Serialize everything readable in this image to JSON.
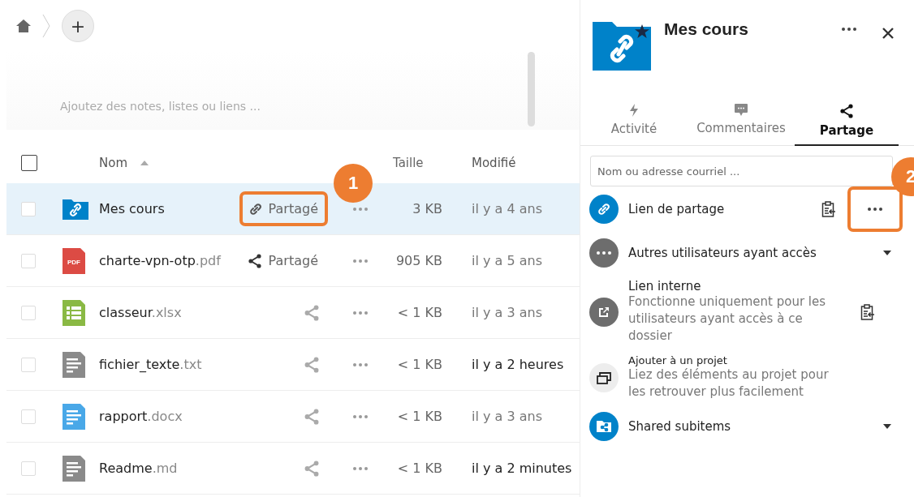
{
  "toolbar": {
    "add_label": "+"
  },
  "notes": {
    "placeholder": "Ajoutez des notes, listes ou liens ..."
  },
  "table": {
    "columns": [
      {
        "label": "Nom",
        "sorted": true
      },
      {
        "label": "Taille"
      },
      {
        "label": "Modifié"
      }
    ],
    "all_checked": false,
    "rows": [
      {
        "name": "Mes cours",
        "ext": "",
        "kind": "folder",
        "selected": true,
        "share": {
          "kind": "link",
          "label": "Partagé"
        },
        "callout": "1",
        "size": "3 KB",
        "modified": "il y a 4 ans",
        "recent": false
      },
      {
        "name": "charte-vpn-otp",
        "ext": ".pdf",
        "kind": "pdf",
        "icon_text": "PDF",
        "selected": false,
        "share": {
          "kind": "shared",
          "label": "Partagé"
        },
        "size": "905 KB",
        "modified": "il y a 5 ans",
        "recent": false
      },
      {
        "name": "classeur",
        "ext": ".xlsx",
        "kind": "spreadsheet",
        "selected": false,
        "share": {
          "kind": "none"
        },
        "size": "< 1 KB",
        "modified": "il y a 3 ans",
        "recent": false
      },
      {
        "name": "fichier_texte",
        "ext": ".txt",
        "kind": "text",
        "selected": false,
        "share": {
          "kind": "none"
        },
        "size": "< 1 KB",
        "modified": "il y a 2 heures",
        "recent": true
      },
      {
        "name": "rapport",
        "ext": ".docx",
        "kind": "document",
        "selected": false,
        "share": {
          "kind": "none"
        },
        "size": "< 1 KB",
        "modified": "il y a 3 ans",
        "recent": false
      },
      {
        "name": "Readme",
        "ext": ".md",
        "kind": "text",
        "selected": false,
        "share": {
          "kind": "none"
        },
        "size": "< 1 KB",
        "modified": "il y a 2 minutes",
        "recent": true
      }
    ]
  },
  "sidebar": {
    "title": "Mes cours",
    "favorite": true,
    "tabs": [
      {
        "label": "Activité",
        "kind": "activity",
        "selected": false
      },
      {
        "label": "Commentaires",
        "kind": "comments",
        "selected": false
      },
      {
        "label": "Partage",
        "kind": "sharing",
        "selected": true
      }
    ],
    "search": {
      "placeholder": "Nom ou adresse courriel ..."
    },
    "entries": [
      {
        "kind": "link",
        "title": "Lien de partage",
        "copyable": true,
        "menu": true,
        "expandable": false,
        "callout": "2"
      },
      {
        "kind": "others",
        "title": "Autres utilisateurs ayant accès",
        "copyable": false,
        "menu": false,
        "expandable": true
      },
      {
        "kind": "internal",
        "title": "Lien interne",
        "description": "Fonctionne uniquement pour les utilisateurs ayant accès à ce dossier",
        "copyable": true,
        "menu": false,
        "expandable": false
      },
      {
        "kind": "project",
        "title": "Ajouter à un projet",
        "description": "Liez des éléments au projet pour les retrouver plus facilement",
        "copyable": false,
        "menu": false,
        "expandable": false
      },
      {
        "kind": "subitems",
        "title": "Shared subitems",
        "copyable": false,
        "menu": false,
        "expandable": true
      }
    ]
  }
}
